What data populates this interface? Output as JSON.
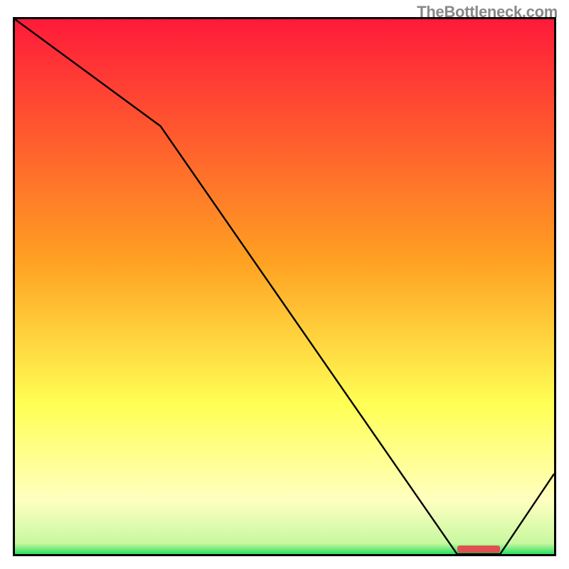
{
  "watermark": "TheBottleneck.com",
  "colors": {
    "topRed": "#ff1a3a",
    "midOrange": "#ffa022",
    "yellow": "#ffff55",
    "paleYellow": "#ffffc0",
    "green": "#2ae060",
    "line": "#000000",
    "marker": "#e05050"
  },
  "chart_data": {
    "type": "line",
    "x": [
      0,
      0.27,
      0.82,
      0.9,
      1.0
    ],
    "values": [
      1.0,
      0.8,
      0.0,
      0.0,
      0.15
    ],
    "title": "",
    "xlabel": "",
    "ylabel": "",
    "xlim": [
      0,
      1
    ],
    "ylim": [
      0,
      1
    ],
    "annotations": {
      "marker_x_range": [
        0.82,
        0.9
      ],
      "marker_y": 0.0
    },
    "gradient_stops": [
      {
        "offset": 0.0,
        "color": "#ff1a3a"
      },
      {
        "offset": 0.45,
        "color": "#ffa022"
      },
      {
        "offset": 0.72,
        "color": "#ffff55"
      },
      {
        "offset": 0.9,
        "color": "#ffffc0"
      },
      {
        "offset": 0.98,
        "color": "#c8f8a0"
      },
      {
        "offset": 1.0,
        "color": "#2ae060"
      }
    ]
  }
}
